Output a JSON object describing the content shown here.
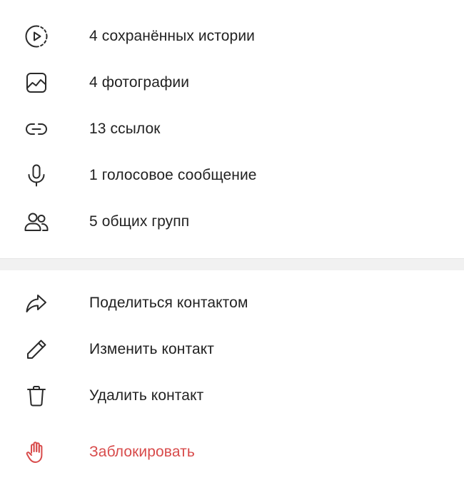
{
  "media": {
    "items": [
      {
        "label": "4 сохранённых истории",
        "icon": "stories-icon"
      },
      {
        "label": "4 фотографии",
        "icon": "photo-icon"
      },
      {
        "label": "13 ссылок",
        "icon": "link-icon"
      },
      {
        "label": "1 голосовое сообщение",
        "icon": "microphone-icon"
      },
      {
        "label": "5 общих групп",
        "icon": "groups-icon"
      }
    ]
  },
  "actions": {
    "items": [
      {
        "label": "Поделиться контактом",
        "icon": "share-icon"
      },
      {
        "label": "Изменить контакт",
        "icon": "pencil-icon"
      },
      {
        "label": "Удалить контакт",
        "icon": "trash-icon"
      },
      {
        "label": "Заблокировать",
        "icon": "hand-icon"
      }
    ]
  },
  "colors": {
    "text": "#222222",
    "danger": "#d84b4b",
    "divider": "#f1f1f1"
  }
}
